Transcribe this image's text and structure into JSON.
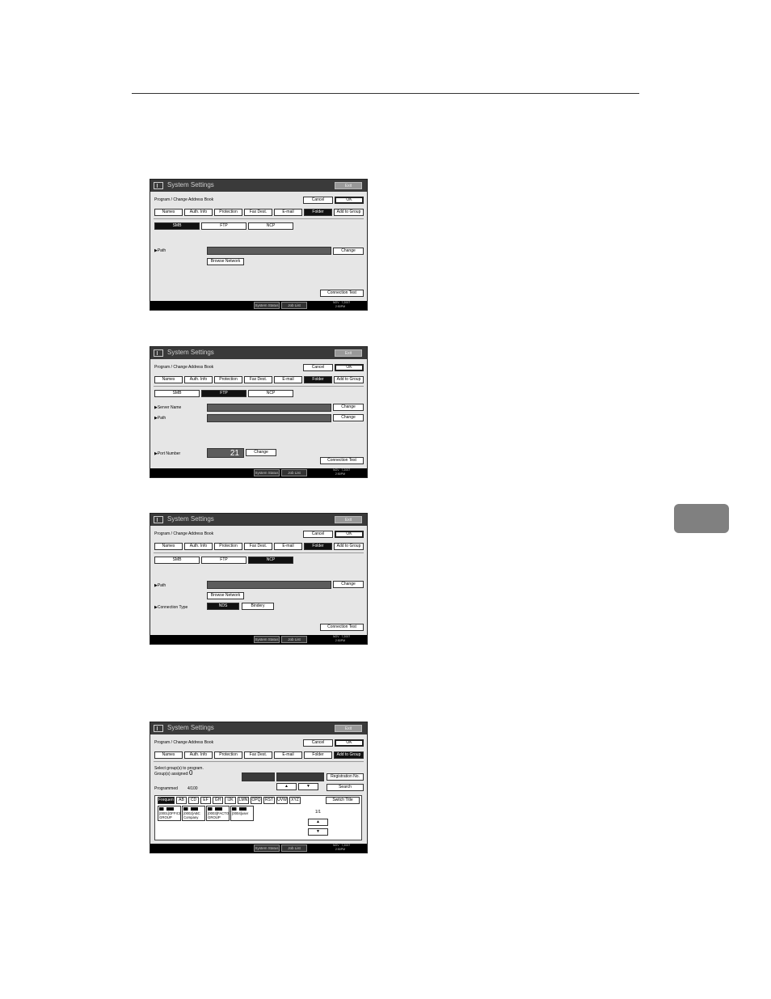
{
  "screens": [
    {
      "title": "System Settings",
      "exit_label": "Exit",
      "breadcrumb": "Program / Change Address Book",
      "cancel_label": "Cancel",
      "ok_label": "OK",
      "tabs": [
        "Names",
        "Auth. Info",
        "Protection",
        "Fax Dest.",
        "E-mail",
        "Folder",
        "Add to Group"
      ],
      "selected_tab": "Folder",
      "protocols": [
        "SMB",
        "FTP",
        "NCP"
      ],
      "selected_protocol": "SMB",
      "path_label": "▶Path",
      "change_label": "Change",
      "browse_label": "Browse Network",
      "connection_test_label": "Connection Test",
      "system_status_label": "System Status",
      "job_list_label": "Job List",
      "date_text": "NOV   7,2007\n   2:50PM"
    },
    {
      "title": "System Settings",
      "exit_label": "Exit",
      "breadcrumb": "Program / Change Address Book",
      "cancel_label": "Cancel",
      "ok_label": "OK",
      "tabs": [
        "Names",
        "Auth. Info",
        "Protection",
        "Fax Dest.",
        "E-mail",
        "Folder",
        "Add to Group"
      ],
      "selected_tab": "Folder",
      "protocols": [
        "SMB",
        "FTP",
        "NCP"
      ],
      "selected_protocol": "FTP",
      "server_name_label": "▶Server Name",
      "path_label": "▶Path",
      "port_label": "▶Port Number",
      "port_value": "21",
      "change_label": "Change",
      "connection_test_label": "Connection Test",
      "system_status_label": "System Status",
      "job_list_label": "Job List",
      "date_text": "NOV   7,2007\n   2:50PM"
    },
    {
      "title": "System Settings",
      "exit_label": "Exit",
      "breadcrumb": "Program / Change Address Book",
      "cancel_label": "Cancel",
      "ok_label": "OK",
      "tabs": [
        "Names",
        "Auth. Info",
        "Protection",
        "Fax Dest.",
        "E-mail",
        "Folder",
        "Add to Group"
      ],
      "selected_tab": "Folder",
      "protocols": [
        "SMB",
        "FTP",
        "NCP"
      ],
      "selected_protocol": "NCP",
      "path_label": "▶Path",
      "change_label": "Change",
      "browse_label": "Browse Network",
      "connection_type_label": "▶Connection Type",
      "connection_types": [
        "NDS",
        "Bindery"
      ],
      "selected_connection_type": "NDS",
      "connection_test_label": "Connection Test",
      "system_status_label": "System Status",
      "job_list_label": "Job List",
      "date_text": "NOV   7,2007\n   2:50PM"
    },
    {
      "title": "System Settings",
      "exit_label": "Exit",
      "breadcrumb": "Program / Change Address Book",
      "cancel_label": "Cancel",
      "ok_label": "OK",
      "tabs": [
        "Names",
        "Auth. Info",
        "Protection",
        "Fax Dest.",
        "E-mail",
        "Folder",
        "Add to Group"
      ],
      "selected_tab": "Add to Group",
      "select_text": "Select group(s) to program.",
      "groups_assigned_label": "Group(s) assigned:",
      "groups_assigned_value": "0",
      "programmed_label": "Programmed",
      "programmed_value": "4/100",
      "registration_label": "Registration No.",
      "search_label": "Search",
      "up_arrow": "▲",
      "down_arrow": "▼",
      "index_tabs": [
        "Frequent",
        "AB",
        "CD",
        "EF",
        "GH",
        "IJK",
        "LMN",
        "OPQ",
        "RST",
        "UVW",
        "XYZ"
      ],
      "selected_index": "Frequent",
      "switch_title_label": "Switch Title",
      "entries": [
        "[0001]OFFICE GROUP",
        "[0002]ABC Company",
        "[0003]FACTORY GROUP",
        "[0004]user"
      ],
      "page_indicator": "1/1",
      "system_status_label": "System Status",
      "job_list_label": "Job List",
      "date_text": "NOV   7,2007\n   2:50PM"
    }
  ]
}
